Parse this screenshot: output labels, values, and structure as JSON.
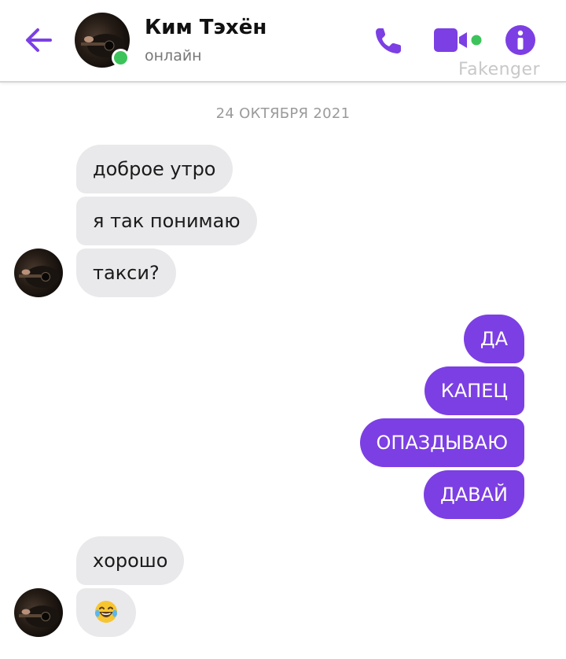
{
  "header": {
    "contact_name": "Ким Тэхён",
    "status": "онлайн",
    "watermark": "Fakenger",
    "icons": {
      "back": "back-arrow-icon",
      "call": "phone-icon",
      "video": "video-camera-icon",
      "info": "info-icon"
    },
    "accent_color": "#7c3fe3",
    "online_color": "#3cc45a"
  },
  "date_separator": "24 ОКТЯБРЯ 2021",
  "messages": [
    {
      "side": "in",
      "text": "доброе утро"
    },
    {
      "side": "in",
      "text": "я так понимаю"
    },
    {
      "side": "in",
      "text": "такси?"
    },
    {
      "side": "out",
      "text": "ДА"
    },
    {
      "side": "out",
      "text": "КАПЕЦ"
    },
    {
      "side": "out",
      "text": "ОПАЗДЫВАЮ"
    },
    {
      "side": "out",
      "text": "ДАВАЙ"
    },
    {
      "side": "in",
      "text": "хорошо"
    },
    {
      "side": "in",
      "text": "",
      "emoji": "face-with-tears-of-joy"
    }
  ],
  "colors": {
    "incoming_bubble": "#e9e9eb",
    "outgoing_bubble": "#7c3fe3"
  }
}
